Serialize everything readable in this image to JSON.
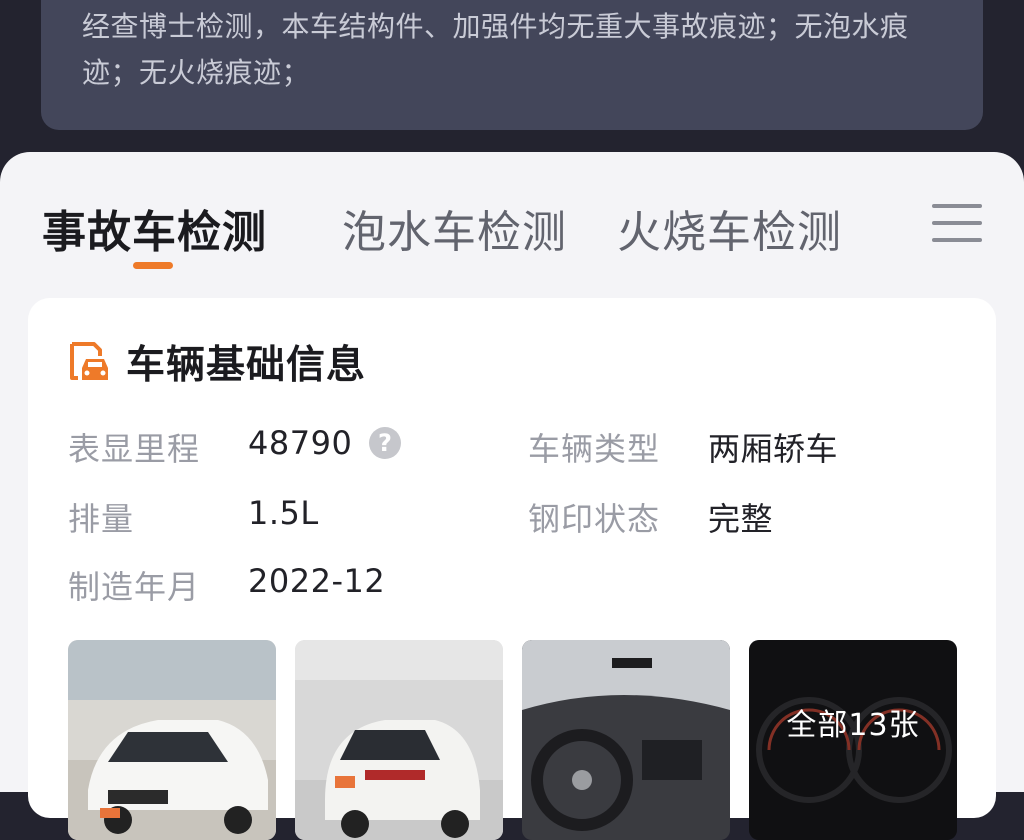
{
  "summary": {
    "text": "经查博士检测，本车结构件、加强件均无重大事故痕迹；无泡水痕迹；无火烧痕迹；"
  },
  "tabs": [
    {
      "label": "事故车检测",
      "active": true
    },
    {
      "label": "泡水车检测",
      "active": false
    },
    {
      "label": "火烧车检测",
      "active": false
    }
  ],
  "accent_color": "#ee7a29",
  "info": {
    "title": "车辆基础信息",
    "icon": "car-document-icon",
    "fields": {
      "mileage": {
        "label": "表显里程",
        "value": "48790"
      },
      "vehicle_type": {
        "label": "车辆类型",
        "value": "两厢轿车"
      },
      "displacement": {
        "label": "排量",
        "value": "1.5L"
      },
      "stamp_status": {
        "label": "钢印状态",
        "value": "完整"
      },
      "manufacture_date": {
        "label": "制造年月",
        "value": "2022-12"
      }
    }
  },
  "photos": {
    "all_label": "全部13张"
  }
}
